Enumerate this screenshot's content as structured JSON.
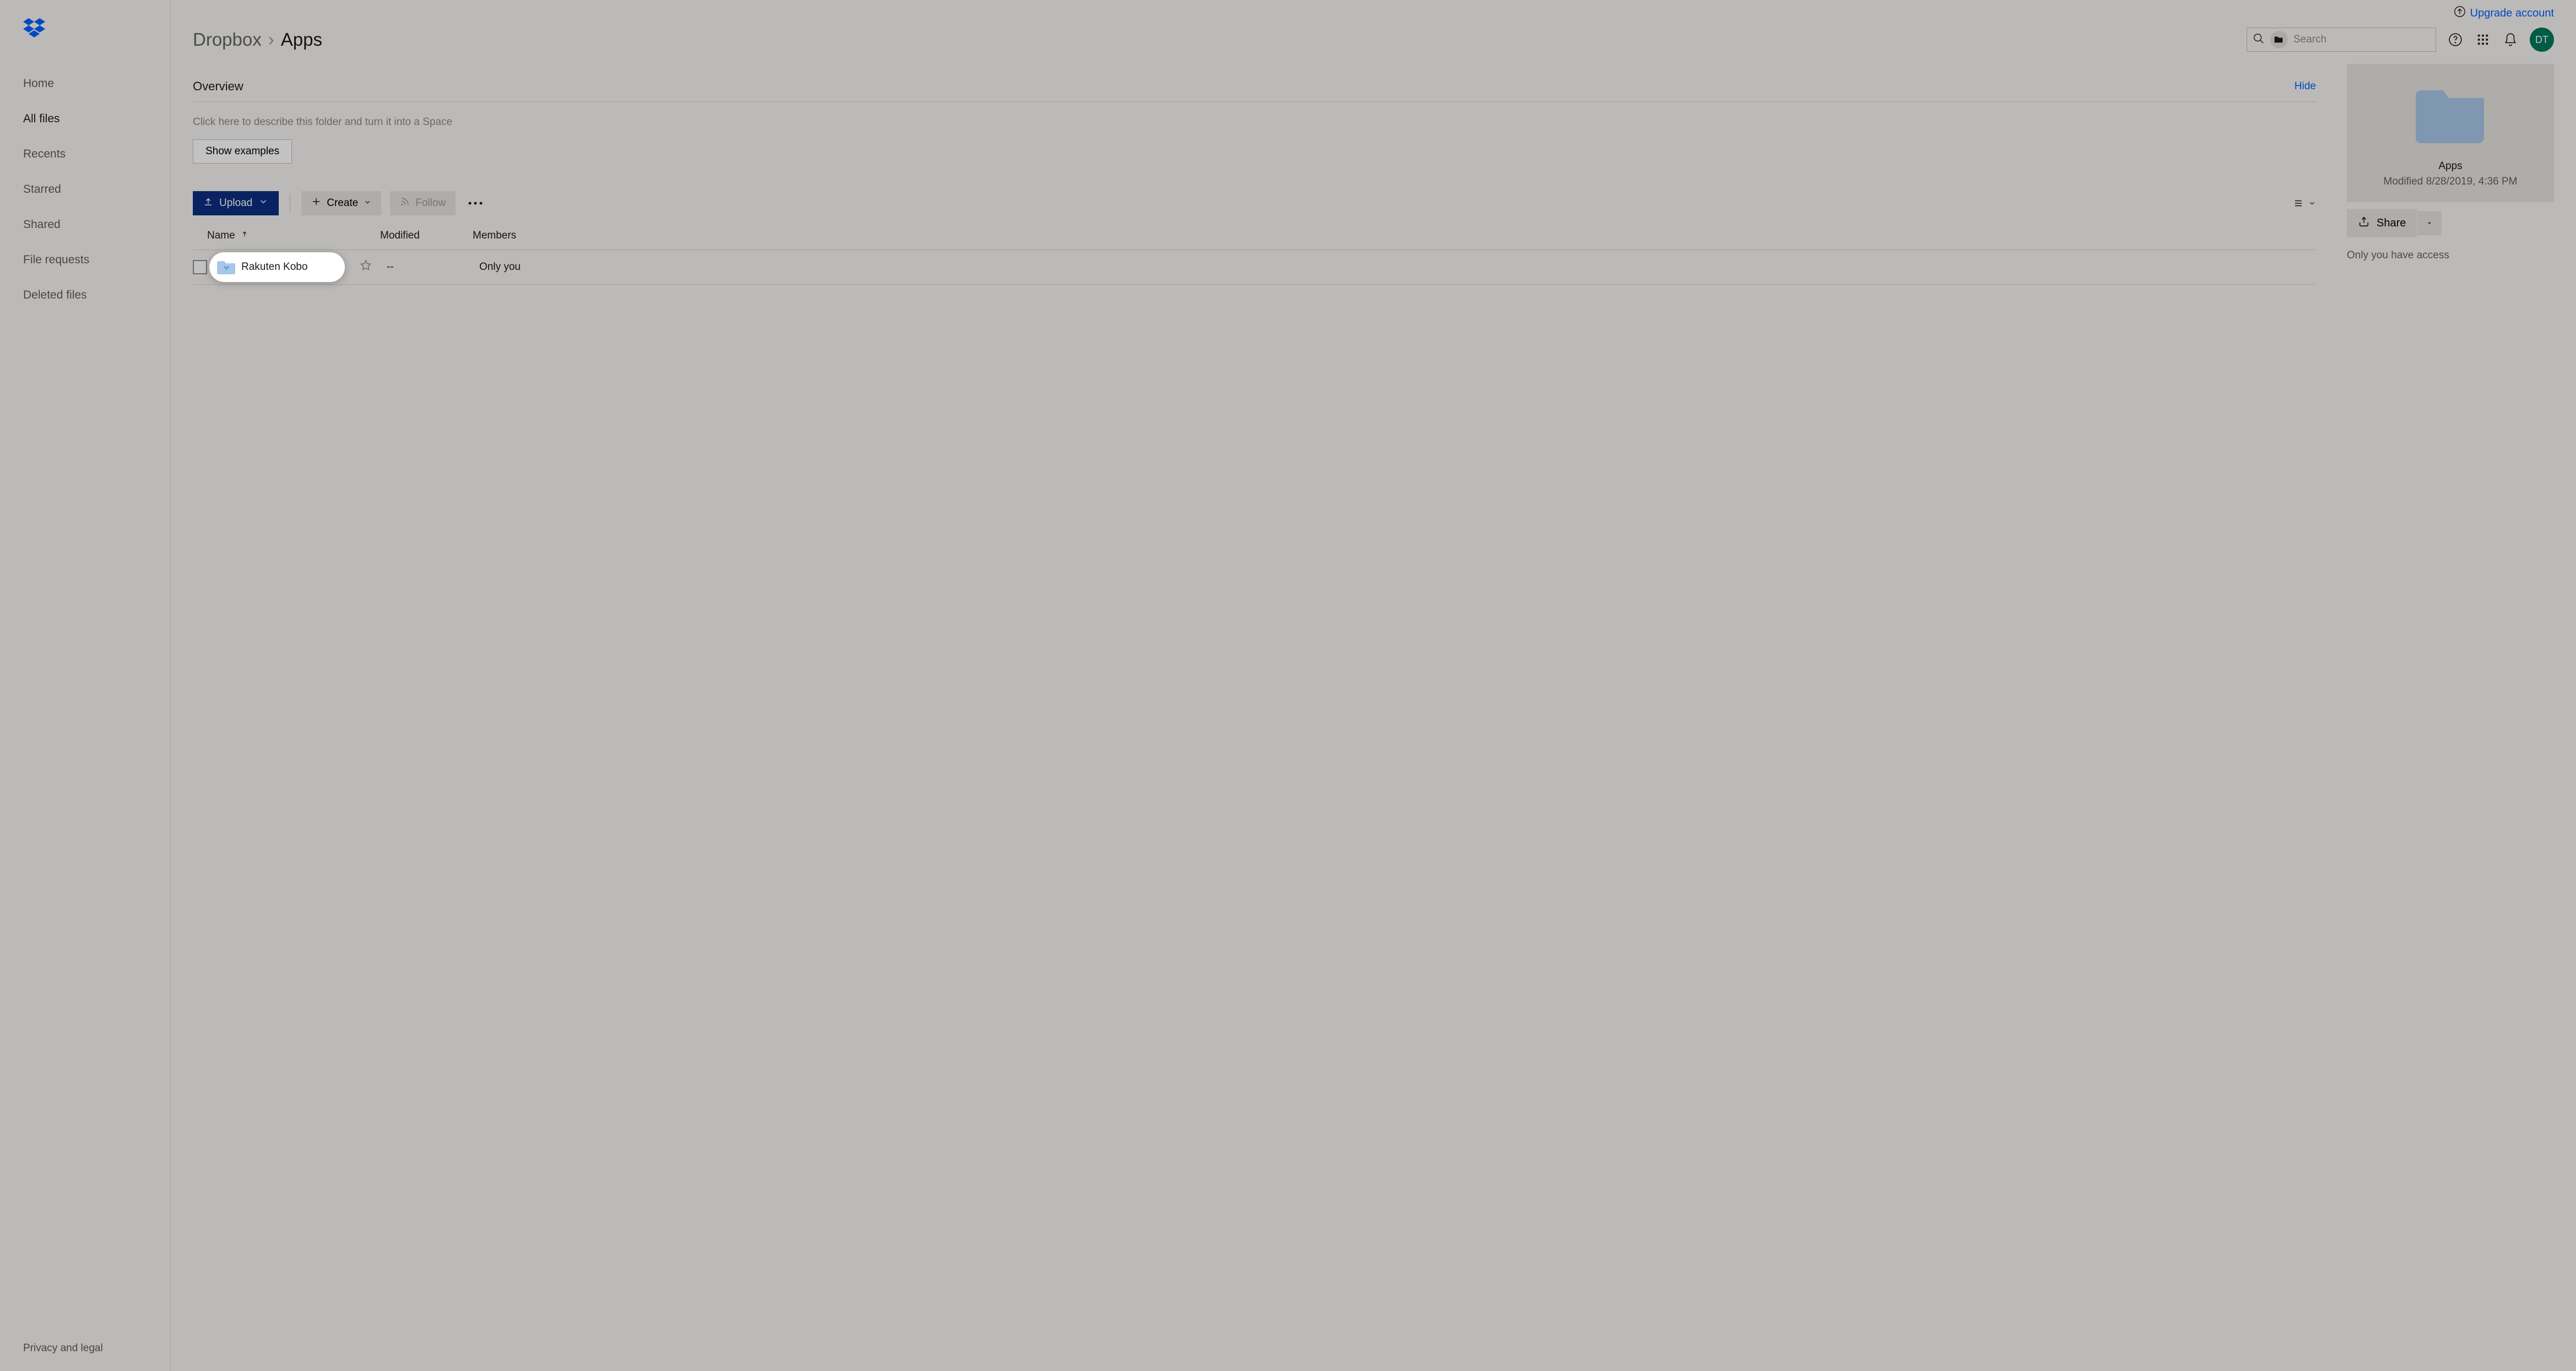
{
  "topbar": {
    "upgrade_label": "Upgrade account"
  },
  "sidebar": {
    "items": [
      {
        "label": "Home"
      },
      {
        "label": "All files"
      },
      {
        "label": "Recents"
      },
      {
        "label": "Starred"
      },
      {
        "label": "Shared"
      },
      {
        "label": "File requests"
      },
      {
        "label": "Deleted files"
      }
    ],
    "privacy_label": "Privacy and legal"
  },
  "breadcrumb": {
    "root": "Dropbox",
    "current": "Apps"
  },
  "search": {
    "placeholder": "Search"
  },
  "avatar": {
    "initials": "DT"
  },
  "overview": {
    "title": "Overview",
    "hide_label": "Hide",
    "placeholder": "Click here to describe this folder and turn it into a Space",
    "show_examples_label": "Show examples"
  },
  "toolbar": {
    "upload_label": "Upload",
    "create_label": "Create",
    "follow_label": "Follow"
  },
  "columns": {
    "name": "Name",
    "modified": "Modified",
    "members": "Members"
  },
  "rows": [
    {
      "name": "Rakuten Kobo",
      "modified": "--",
      "members": "Only you"
    }
  ],
  "info_panel": {
    "name": "Apps",
    "modified": "Modified 8/28/2019, 4:36 PM",
    "share_label": "Share",
    "access_note": "Only you have access"
  }
}
